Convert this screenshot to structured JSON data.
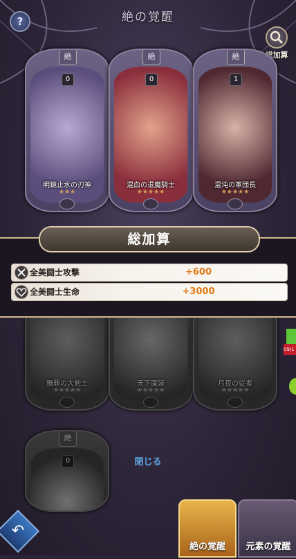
{
  "header": {
    "title": "絶の覚醒",
    "help_icon": "?",
    "summary_label": "総加算"
  },
  "cards_top": [
    {
      "tag": "絶",
      "count": "0",
      "name": "明鏡止水の刃神",
      "stars": "★★★",
      "art": "#7b6b98"
    },
    {
      "tag": "絶",
      "count": "0",
      "name": "混血の退魔騎士",
      "stars": "★★★★★",
      "art": "#a0535a"
    },
    {
      "tag": "絶",
      "count": "1",
      "name": "混沌の軍団長",
      "stars": "★★★★★",
      "art": "#6a3b45"
    }
  ],
  "cards_mid": [
    {
      "name": "贖罪の大剣士",
      "stars": "★★★★★"
    },
    {
      "name": "天下魔装",
      "stars": "★★★★★"
    },
    {
      "name": "月夜の従者",
      "stars": "★★★★★"
    }
  ],
  "card_bottom": {
    "tag": "絶",
    "count": "0"
  },
  "modal": {
    "title": "総加算",
    "rows": [
      {
        "label": "全美闘士攻撃",
        "value": "+600",
        "icon": "swords-icon"
      },
      {
        "label": "全美闘士生命",
        "value": "+3000",
        "icon": "heart-icon"
      }
    ]
  },
  "close_label": "閉じる",
  "side": {
    "date": "09/1"
  },
  "tabs": [
    {
      "label": "絶の覚醒"
    },
    {
      "label": "元素の覚醒"
    }
  ],
  "colors": {
    "accent_orange": "#e07a18",
    "close_blue": "#5fa8e8",
    "gold": "#d2b98e"
  }
}
